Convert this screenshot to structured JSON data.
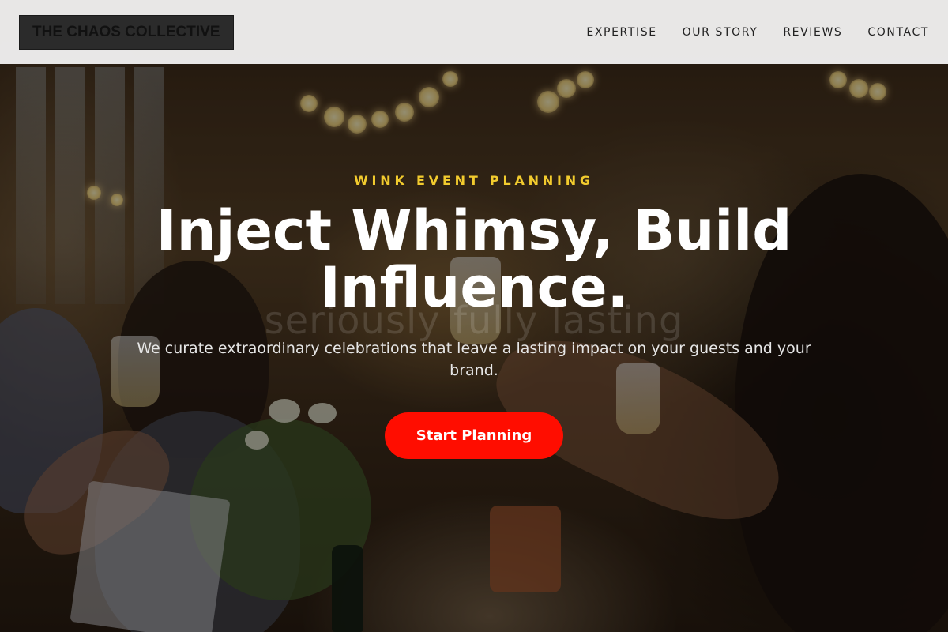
{
  "header": {
    "brand": "THE CHAOS COLLECTIVE",
    "nav": [
      {
        "label": "EXPERTISE"
      },
      {
        "label": "OUR STORY"
      },
      {
        "label": "REVIEWS"
      },
      {
        "label": "CONTACT"
      }
    ]
  },
  "hero": {
    "eyebrow": "WINK EVENT PLANNING",
    "headline": "Inject Whimsy, Build Influence.",
    "ghost_text": "seriously fully lasting",
    "subtitle": "We curate extraordinary celebrations that leave a lasting impact on your guests and your brand.",
    "cta_label": "Start Planning"
  },
  "colors": {
    "accent_yellow": "#f2cb2e",
    "cta_red": "#ff0d00",
    "header_bg": "#f4f4f4",
    "logo_bg": "#2b2b2b"
  }
}
